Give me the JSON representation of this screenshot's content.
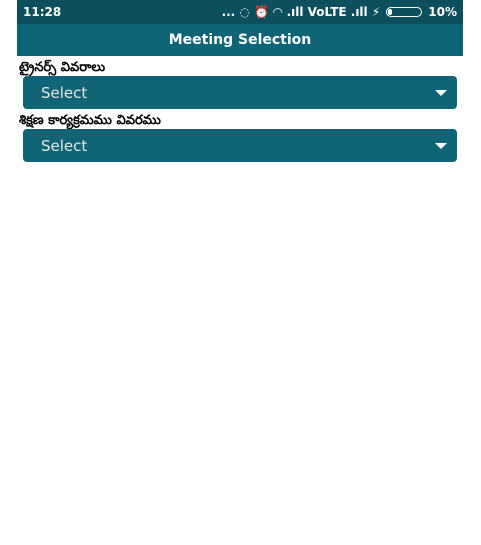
{
  "status_bar": {
    "time": "11:28",
    "icons_text": "... ◌ ⏰ ◠ .ıll VoLTE .ıll ⚡",
    "battery_percent": "10%",
    "battery_level": 0.1
  },
  "app_bar": {
    "title": "Meeting Selection"
  },
  "form": {
    "fields": [
      {
        "label": "ట్రైనర్స్ వివరాలు",
        "value": "Select"
      },
      {
        "label": "శిక్షణ కార్యక్రమము వివరము",
        "value": "Select"
      }
    ]
  }
}
